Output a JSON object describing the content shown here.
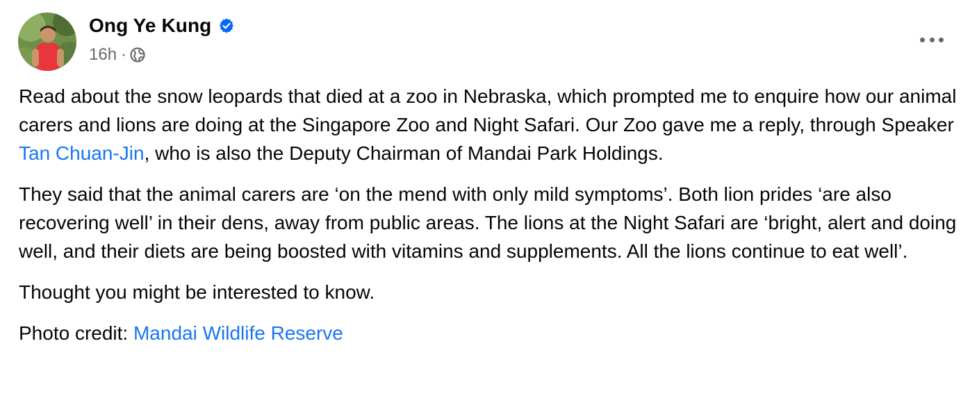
{
  "post": {
    "author": {
      "name": "Ong Ye Kung",
      "verified": true
    },
    "timestamp": "16h",
    "separator": "·",
    "audience_icon": "globe-icon",
    "more_icon": "more-options-icon",
    "paragraph1": {
      "before_link": "Read about the snow leopards that died at a zoo in Nebraska, which prompted me to enquire how our animal carers and lions are doing at the Singapore Zoo and Night Safari. Our Zoo gave me a reply, through Speaker ",
      "link": "Tan Chuan-Jin",
      "after_link": ", who is also the Deputy Chairman of Mandai Park Holdings."
    },
    "paragraph2": "They said that the animal carers are ‘on the mend with only mild symptoms’. Both lion prides ‘are also recovering well’ in their dens, away from public areas. The lions at the Night Safari are ‘bright, alert and doing well, and their diets are being boosted with vitamins and supplements. All the lions continue to eat well’.",
    "paragraph3": "Thought you might be interested to know.",
    "paragraph4": {
      "label": "Photo credit: ",
      "link": "Mandai Wildlife Reserve"
    },
    "colors": {
      "link": "#1876f2",
      "verified_badge": "#0866ff",
      "secondary_text": "#65676b"
    }
  }
}
